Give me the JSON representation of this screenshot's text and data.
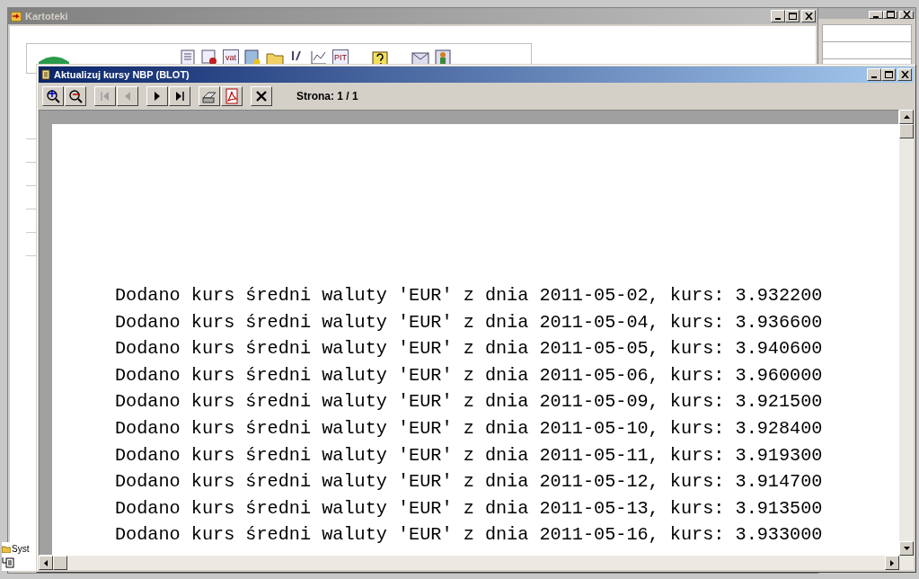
{
  "background_window": {
    "title": "Kartoteki",
    "icon_labels": [
      "vat",
      "PIT"
    ]
  },
  "side_tree": {
    "item": "Syst"
  },
  "report_window": {
    "title": "Aktualizuj kursy NBP (BLOT)",
    "buttons": [
      {
        "kind": "zoom-in"
      },
      {
        "kind": "zoom-out"
      },
      {
        "kind": "first",
        "disabled": true
      },
      {
        "kind": "prev",
        "disabled": true
      },
      {
        "kind": "next",
        "disabled": false
      },
      {
        "kind": "last",
        "disabled": false
      },
      {
        "kind": "print"
      },
      {
        "kind": "pdf"
      },
      {
        "kind": "close"
      }
    ],
    "page_label": "Strona: 1 / 1",
    "lines": [
      "Dodano kurs średni waluty 'EUR' z dnia 2011-05-02, kurs: 3.932200",
      "Dodano kurs średni waluty 'EUR' z dnia 2011-05-04, kurs: 3.936600",
      "Dodano kurs średni waluty 'EUR' z dnia 2011-05-05, kurs: 3.940600",
      "Dodano kurs średni waluty 'EUR' z dnia 2011-05-06, kurs: 3.960000",
      "Dodano kurs średni waluty 'EUR' z dnia 2011-05-09, kurs: 3.921500",
      "Dodano kurs średni waluty 'EUR' z dnia 2011-05-10, kurs: 3.928400",
      "Dodano kurs średni waluty 'EUR' z dnia 2011-05-11, kurs: 3.919300",
      "Dodano kurs średni waluty 'EUR' z dnia 2011-05-12, kurs: 3.914700",
      "Dodano kurs średni waluty 'EUR' z dnia 2011-05-13, kurs: 3.913500",
      "Dodano kurs średni waluty 'EUR' z dnia 2011-05-16, kurs: 3.933000"
    ]
  }
}
